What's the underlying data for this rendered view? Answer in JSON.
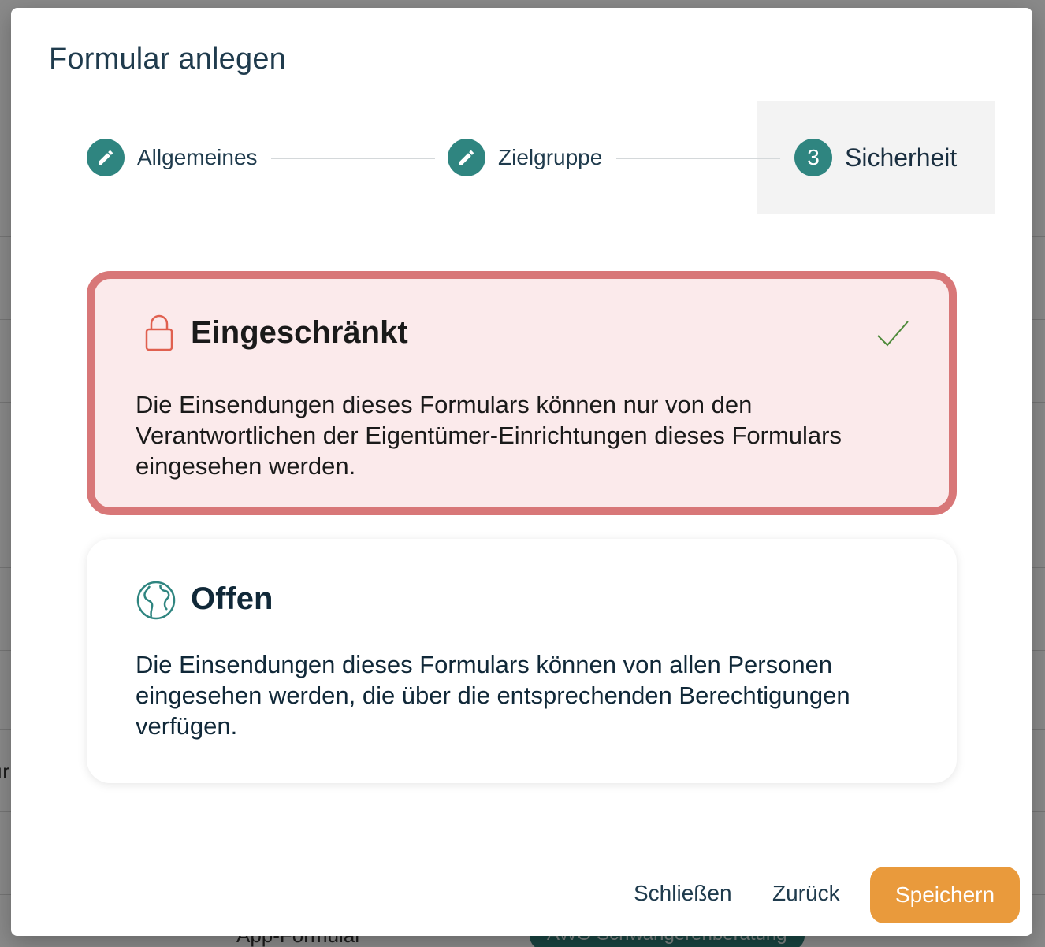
{
  "background": {
    "row_text_1": "App-Formular",
    "row_badge_1": "AWO Schwangerenberatung",
    "edge_text": "ır"
  },
  "dialog": {
    "title": "Formular anlegen",
    "stepper": {
      "steps": [
        {
          "label": "Allgemeines",
          "status": "completed",
          "icon": "pencil-icon"
        },
        {
          "label": "Zielgruppe",
          "status": "completed",
          "icon": "pencil-icon"
        },
        {
          "label": "Sicherheit",
          "status": "active",
          "number": "3"
        }
      ]
    },
    "options": {
      "restricted": {
        "title": "Eingeschränkt",
        "description": "Die Einsendungen dieses Formulars können nur von den Verantwortlichen der Eigentümer-Einrichtungen dieses Formulars eingesehen werden.",
        "icon": "lock-icon",
        "selected": true
      },
      "open": {
        "title": "Offen",
        "description": "Die Einsendungen dieses Formulars können von allen Personen eingesehen werden, die über die entsprechenden Berechtigungen verfügen.",
        "icon": "globe-icon",
        "selected": false
      }
    },
    "footer": {
      "close_label": "Schließen",
      "back_label": "Zurück",
      "save_label": "Speichern"
    }
  },
  "colors": {
    "primary_teal": "#2f8580",
    "selected_border": "#d87778",
    "selected_bg": "#fbeaeb",
    "save_button": "#e99a3c",
    "check": "#4e8a3a"
  }
}
